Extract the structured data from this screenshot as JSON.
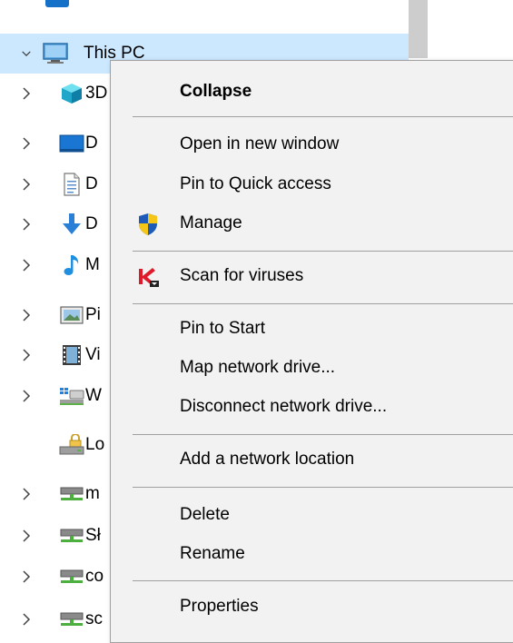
{
  "window": {
    "background": "#ffffff",
    "selection_color": "#cce8ff",
    "menu_background": "#f2f2f2"
  },
  "nav_tree": {
    "root": {
      "label": "This PC",
      "icon": "this-pc-icon",
      "expanded": true,
      "selected": true
    },
    "items": [
      {
        "label": "3D",
        "icon": "3d-objects-icon",
        "has_chevron": true
      },
      {
        "label": "D",
        "icon": "desktop-icon",
        "has_chevron": true
      },
      {
        "label": "D",
        "icon": "documents-icon",
        "has_chevron": true
      },
      {
        "label": "D",
        "icon": "downloads-icon",
        "has_chevron": true
      },
      {
        "label": "M",
        "icon": "music-icon",
        "has_chevron": true
      },
      {
        "label": "Pi",
        "icon": "pictures-icon",
        "has_chevron": true
      },
      {
        "label": "Vi",
        "icon": "videos-icon",
        "has_chevron": true
      },
      {
        "label": "W",
        "icon": "network-drive-icon",
        "has_chevron": true
      },
      {
        "label": "Lo",
        "icon": "locked-drive-icon",
        "has_chevron": false
      },
      {
        "label": "m",
        "icon": "network-share-icon",
        "has_chevron": true
      },
      {
        "label": "Sł",
        "icon": "network-share-icon",
        "has_chevron": true
      },
      {
        "label": "co",
        "icon": "network-share-icon",
        "has_chevron": true
      },
      {
        "label": "sc",
        "icon": "network-share-icon",
        "has_chevron": true
      }
    ]
  },
  "context_menu": {
    "items": [
      {
        "label": "Collapse",
        "bold": true
      },
      {
        "label": "Open in new window"
      },
      {
        "label": "Pin to Quick access"
      },
      {
        "label": "Manage",
        "icon": "uac-shield-icon"
      },
      {
        "label": "Scan for viruses",
        "icon": "kaspersky-icon"
      },
      {
        "label": "Pin to Start"
      },
      {
        "label": "Map network drive..."
      },
      {
        "label": "Disconnect network drive..."
      },
      {
        "label": "Add a network location"
      },
      {
        "label": "Delete"
      },
      {
        "label": "Rename"
      },
      {
        "label": "Properties"
      }
    ]
  }
}
